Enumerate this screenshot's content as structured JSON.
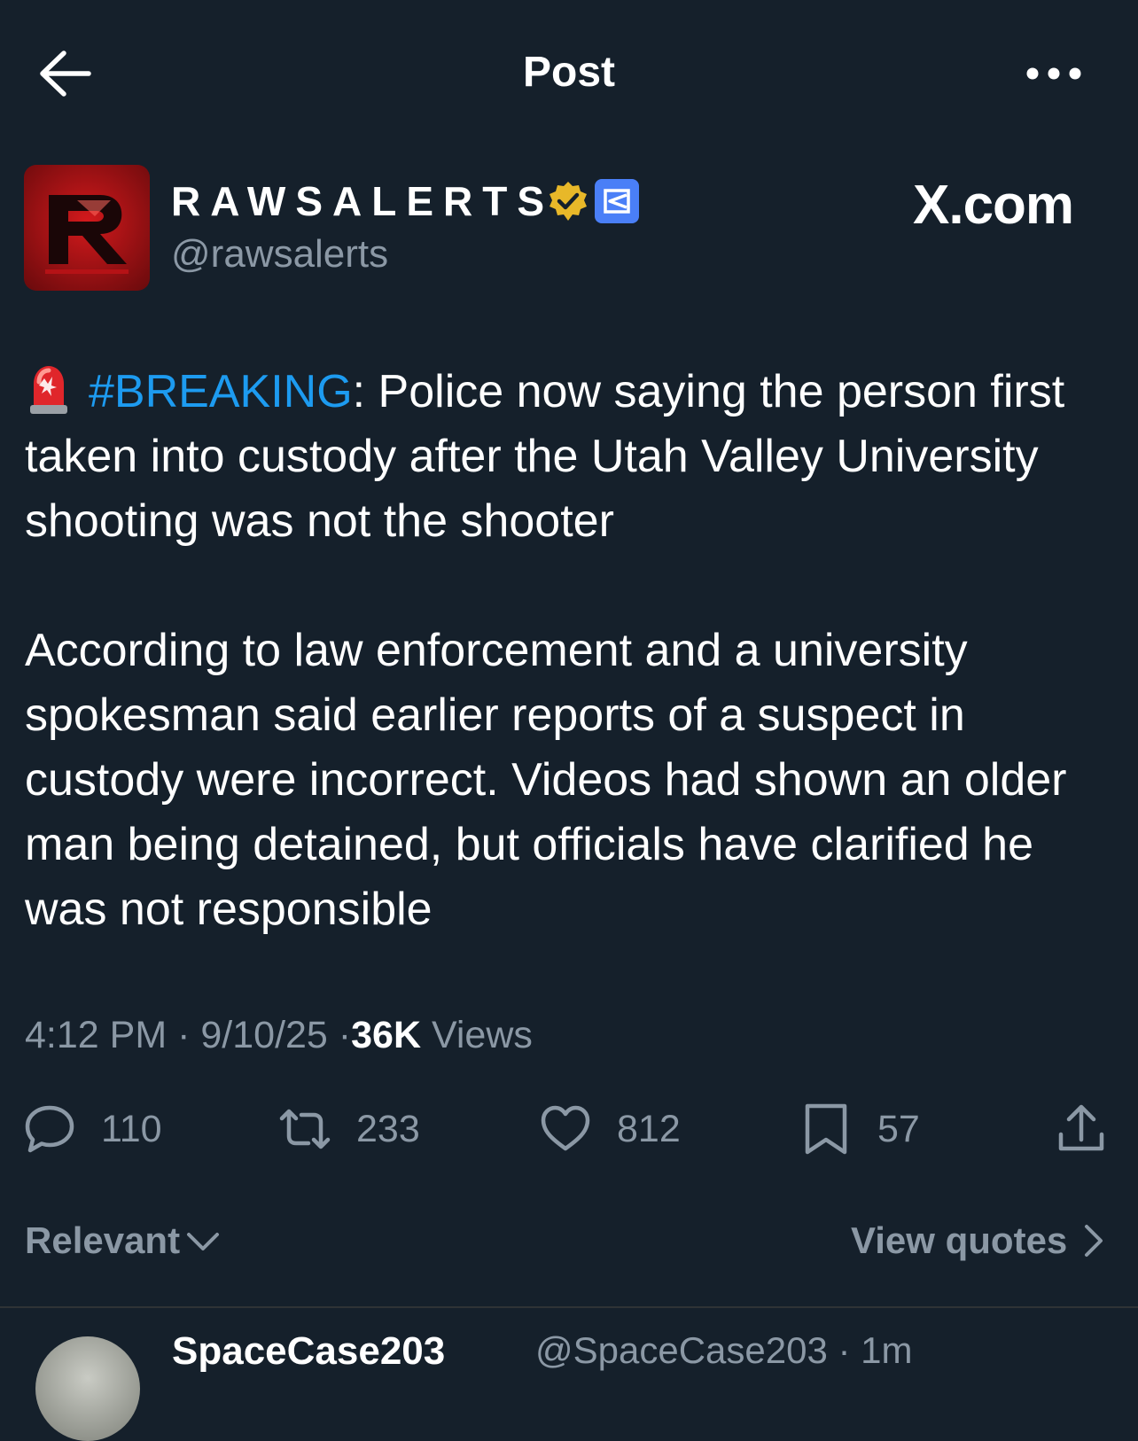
{
  "header": {
    "title": "Post"
  },
  "author": {
    "display_name": "RAWSALERTS",
    "handle": "@rawsalerts",
    "source_label": "X.com"
  },
  "post": {
    "hashtag": "#BREAKING",
    "paragraph1_rest": ": Police now saying the person first taken into custody after the Utah Valley University shooting was not the shooter",
    "paragraph2": "According to law enforcement and a university spokesman said earlier reports of a suspect in custody were incorrect. Videos had shown an older man being detained, but officials have clarified he was not responsible",
    "time": "4:12 PM",
    "date": "9/10/25",
    "separator": "·",
    "views_count": "36K",
    "views_label": "Views"
  },
  "actions": {
    "replies": "110",
    "reposts": "233",
    "likes": "812",
    "bookmarks": "57"
  },
  "sort": {
    "label": "Relevant",
    "view_quotes": "View quotes"
  },
  "next_reply": {
    "name": "SpaceCase203",
    "handle_time": "@SpaceCase203 · 1m"
  },
  "colors": {
    "background": "#15202b",
    "accent": "#1d9bf0",
    "muted": "#8b98a5"
  }
}
